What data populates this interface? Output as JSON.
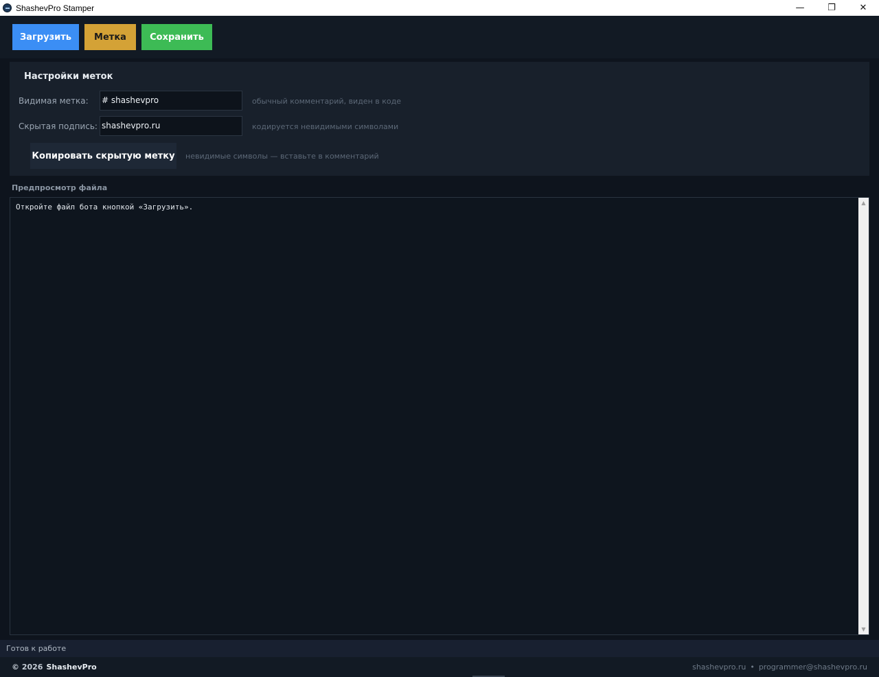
{
  "window": {
    "title": "ShashevPro Stamper",
    "minimize_glyph": "—",
    "restore_glyph": "❐",
    "close_glyph": "✕"
  },
  "toolbar": {
    "load_label": "Загрузить",
    "mark_label": "Метка",
    "save_label": "Сохранить"
  },
  "settings": {
    "title": "Настройки меток",
    "visible_mark": {
      "label": "Видимая метка:",
      "value": "# shashevpro",
      "hint": "обычный комментарий, виден в коде"
    },
    "hidden_signature": {
      "label": "Скрытая подпись:",
      "value": "shashevpro.ru",
      "hint": "кодируется невидимыми символами"
    },
    "copy_button_label": "Копировать скрытую метку",
    "copy_hint": "невидимые символы — вставьте в комментарий"
  },
  "preview": {
    "label": "Предпросмотр файла",
    "content": "Откройте файл бота кнопкой «Загрузить»."
  },
  "status": {
    "text": "Готов к работе"
  },
  "footer": {
    "copyright": "© 2026",
    "brand": "ShashevPro",
    "site": "shashevpro.ru",
    "separator": "•",
    "email": "programmer@shashevpro.ru"
  },
  "colors": {
    "load_button": "#3b8ef5",
    "mark_button": "#d4a236",
    "save_button": "#3dbb55",
    "background": "#0e141d"
  },
  "icons": {
    "app": "app-icon",
    "minimize": "minimize-icon",
    "restore": "restore-icon",
    "close": "close-icon",
    "scroll_up": "scroll-up-icon",
    "scroll_down": "scroll-down-icon"
  }
}
